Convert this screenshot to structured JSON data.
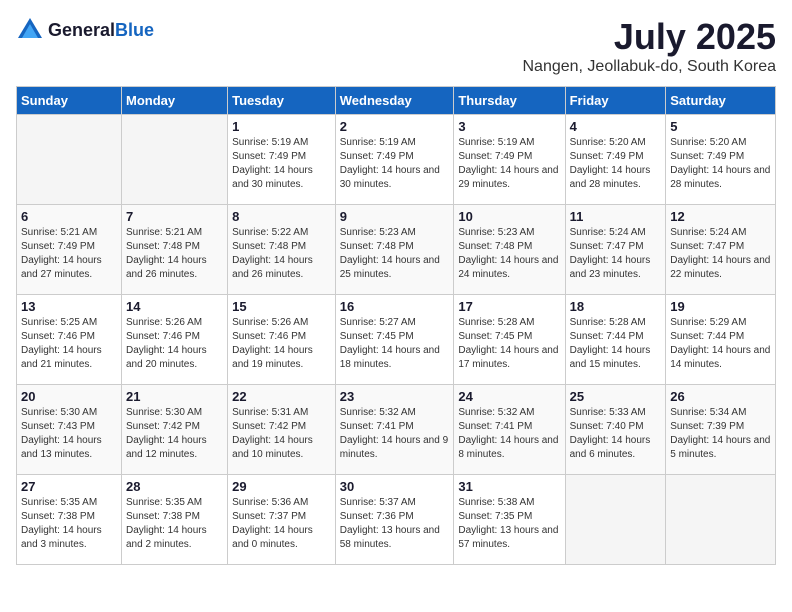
{
  "logo": {
    "general": "General",
    "blue": "Blue"
  },
  "title": "July 2025",
  "subtitle": "Nangen, Jeollabuk-do, South Korea",
  "weekdays": [
    "Sunday",
    "Monday",
    "Tuesday",
    "Wednesday",
    "Thursday",
    "Friday",
    "Saturday"
  ],
  "weeks": [
    [
      {
        "day": "",
        "info": ""
      },
      {
        "day": "",
        "info": ""
      },
      {
        "day": "1",
        "info": "Sunrise: 5:19 AM\nSunset: 7:49 PM\nDaylight: 14 hours and 30 minutes."
      },
      {
        "day": "2",
        "info": "Sunrise: 5:19 AM\nSunset: 7:49 PM\nDaylight: 14 hours and 30 minutes."
      },
      {
        "day": "3",
        "info": "Sunrise: 5:19 AM\nSunset: 7:49 PM\nDaylight: 14 hours and 29 minutes."
      },
      {
        "day": "4",
        "info": "Sunrise: 5:20 AM\nSunset: 7:49 PM\nDaylight: 14 hours and 28 minutes."
      },
      {
        "day": "5",
        "info": "Sunrise: 5:20 AM\nSunset: 7:49 PM\nDaylight: 14 hours and 28 minutes."
      }
    ],
    [
      {
        "day": "6",
        "info": "Sunrise: 5:21 AM\nSunset: 7:49 PM\nDaylight: 14 hours and 27 minutes."
      },
      {
        "day": "7",
        "info": "Sunrise: 5:21 AM\nSunset: 7:48 PM\nDaylight: 14 hours and 26 minutes."
      },
      {
        "day": "8",
        "info": "Sunrise: 5:22 AM\nSunset: 7:48 PM\nDaylight: 14 hours and 26 minutes."
      },
      {
        "day": "9",
        "info": "Sunrise: 5:23 AM\nSunset: 7:48 PM\nDaylight: 14 hours and 25 minutes."
      },
      {
        "day": "10",
        "info": "Sunrise: 5:23 AM\nSunset: 7:48 PM\nDaylight: 14 hours and 24 minutes."
      },
      {
        "day": "11",
        "info": "Sunrise: 5:24 AM\nSunset: 7:47 PM\nDaylight: 14 hours and 23 minutes."
      },
      {
        "day": "12",
        "info": "Sunrise: 5:24 AM\nSunset: 7:47 PM\nDaylight: 14 hours and 22 minutes."
      }
    ],
    [
      {
        "day": "13",
        "info": "Sunrise: 5:25 AM\nSunset: 7:46 PM\nDaylight: 14 hours and 21 minutes."
      },
      {
        "day": "14",
        "info": "Sunrise: 5:26 AM\nSunset: 7:46 PM\nDaylight: 14 hours and 20 minutes."
      },
      {
        "day": "15",
        "info": "Sunrise: 5:26 AM\nSunset: 7:46 PM\nDaylight: 14 hours and 19 minutes."
      },
      {
        "day": "16",
        "info": "Sunrise: 5:27 AM\nSunset: 7:45 PM\nDaylight: 14 hours and 18 minutes."
      },
      {
        "day": "17",
        "info": "Sunrise: 5:28 AM\nSunset: 7:45 PM\nDaylight: 14 hours and 17 minutes."
      },
      {
        "day": "18",
        "info": "Sunrise: 5:28 AM\nSunset: 7:44 PM\nDaylight: 14 hours and 15 minutes."
      },
      {
        "day": "19",
        "info": "Sunrise: 5:29 AM\nSunset: 7:44 PM\nDaylight: 14 hours and 14 minutes."
      }
    ],
    [
      {
        "day": "20",
        "info": "Sunrise: 5:30 AM\nSunset: 7:43 PM\nDaylight: 14 hours and 13 minutes."
      },
      {
        "day": "21",
        "info": "Sunrise: 5:30 AM\nSunset: 7:42 PM\nDaylight: 14 hours and 12 minutes."
      },
      {
        "day": "22",
        "info": "Sunrise: 5:31 AM\nSunset: 7:42 PM\nDaylight: 14 hours and 10 minutes."
      },
      {
        "day": "23",
        "info": "Sunrise: 5:32 AM\nSunset: 7:41 PM\nDaylight: 14 hours and 9 minutes."
      },
      {
        "day": "24",
        "info": "Sunrise: 5:32 AM\nSunset: 7:41 PM\nDaylight: 14 hours and 8 minutes."
      },
      {
        "day": "25",
        "info": "Sunrise: 5:33 AM\nSunset: 7:40 PM\nDaylight: 14 hours and 6 minutes."
      },
      {
        "day": "26",
        "info": "Sunrise: 5:34 AM\nSunset: 7:39 PM\nDaylight: 14 hours and 5 minutes."
      }
    ],
    [
      {
        "day": "27",
        "info": "Sunrise: 5:35 AM\nSunset: 7:38 PM\nDaylight: 14 hours and 3 minutes."
      },
      {
        "day": "28",
        "info": "Sunrise: 5:35 AM\nSunset: 7:38 PM\nDaylight: 14 hours and 2 minutes."
      },
      {
        "day": "29",
        "info": "Sunrise: 5:36 AM\nSunset: 7:37 PM\nDaylight: 14 hours and 0 minutes."
      },
      {
        "day": "30",
        "info": "Sunrise: 5:37 AM\nSunset: 7:36 PM\nDaylight: 13 hours and 58 minutes."
      },
      {
        "day": "31",
        "info": "Sunrise: 5:38 AM\nSunset: 7:35 PM\nDaylight: 13 hours and 57 minutes."
      },
      {
        "day": "",
        "info": ""
      },
      {
        "day": "",
        "info": ""
      }
    ]
  ]
}
